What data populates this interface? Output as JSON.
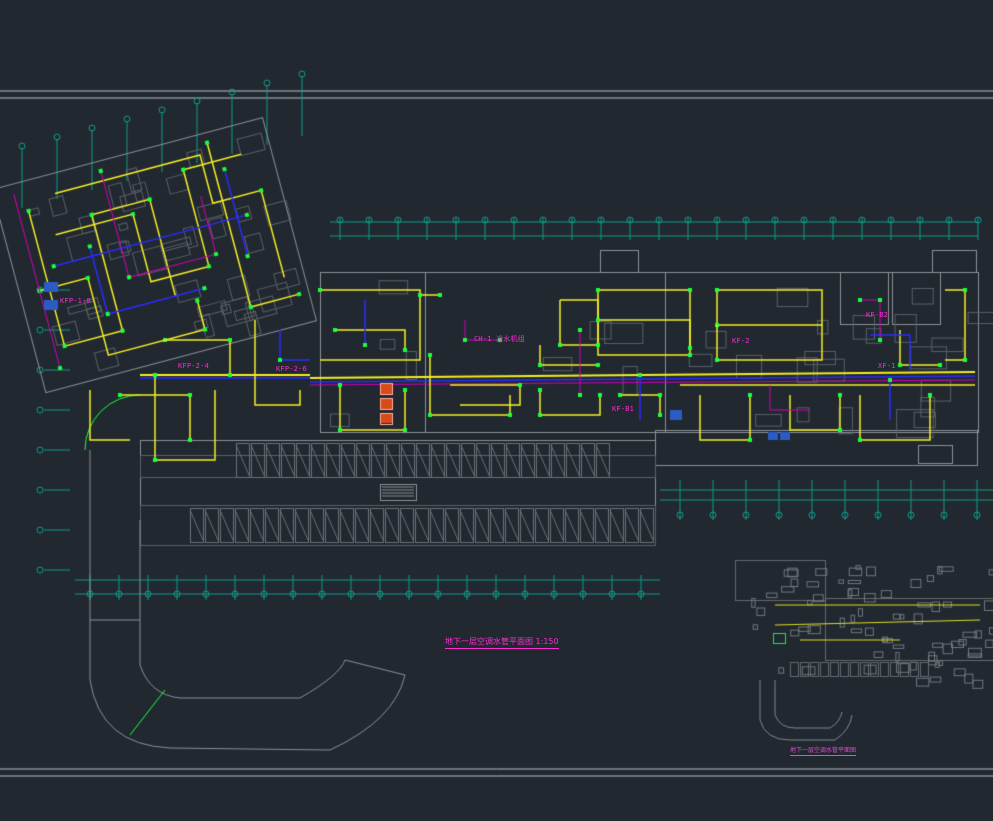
{
  "drawing": {
    "main_title": "地下一层空调水管平面图  1:150",
    "key_plan_title": "地下一层空调水管平面图",
    "tags": [
      {
        "id": "t1",
        "text": "KFP-1-8",
        "x": 0,
        "y": 0
      },
      {
        "id": "t2",
        "text": "KFP-2-4",
        "x": 0,
        "y": 0
      },
      {
        "id": "t3",
        "text": "KFP-2-6",
        "x": 0,
        "y": 0
      },
      {
        "id": "t4",
        "text": "CH-1 冷水机组",
        "x": 0,
        "y": 0
      },
      {
        "id": "t5",
        "text": "KF-2",
        "x": 0,
        "y": 0
      },
      {
        "id": "t6",
        "text": "KF-B1",
        "x": 0,
        "y": 0
      },
      {
        "id": "t7",
        "text": "KF-B2",
        "x": 0,
        "y": 0
      },
      {
        "id": "t8",
        "text": "XF-1",
        "x": 0,
        "y": 0
      }
    ]
  },
  "colors": {
    "background": "#212830",
    "frame": "#b9c0c7",
    "supply_pipe": "#f4ef21",
    "return_pipe": "#2a2cff",
    "condensate_pipe": "#d000b8",
    "terminal_unit": "#19ff3c",
    "grid_axis": "#0f9c88",
    "wall": "#8a9096",
    "text_tag": "#ff2bd6"
  }
}
